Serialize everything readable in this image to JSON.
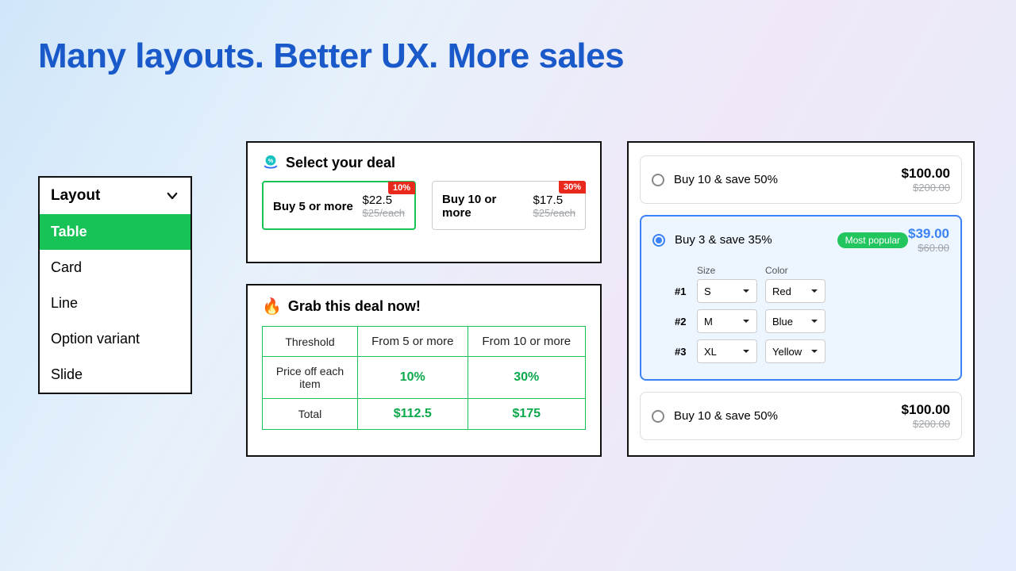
{
  "headline": "Many layouts. Better UX. More sales",
  "layout": {
    "title": "Layout",
    "items": [
      "Table",
      "Card",
      "Line",
      "Option variant",
      "Slide"
    ],
    "active_index": 0
  },
  "deals": {
    "title": "Select your deal",
    "cards": [
      {
        "label": "Buy 5 or more",
        "price": "$22.5",
        "old": "$25/each",
        "badge": "10%",
        "selected": true
      },
      {
        "label": "Buy 10 or more",
        "price": "$17.5",
        "old": "$25/each",
        "badge": "30%",
        "selected": false
      }
    ]
  },
  "grab": {
    "title": "Grab this deal now!",
    "emoji": "🔥",
    "headers": [
      "Threshold",
      "From 5 or more",
      "From 10 or more"
    ],
    "rows": [
      {
        "label": "Price off each item",
        "values": [
          "10%",
          "30%"
        ]
      },
      {
        "label": "Total",
        "values": [
          "$112.5",
          "$175"
        ]
      }
    ]
  },
  "variants": {
    "size_label": "Size",
    "color_label": "Color",
    "items": [
      {
        "label": "Buy 10 & save 50%",
        "price": "$100.00",
        "old": "$200.00",
        "selected": false,
        "tag": ""
      },
      {
        "label": "Buy 3 & save 35%",
        "price": "$39.00",
        "old": "$60.00",
        "selected": true,
        "tag": "Most popular",
        "options": [
          {
            "idx": "#1",
            "size": "S",
            "color": "Red"
          },
          {
            "idx": "#2",
            "size": "M",
            "color": "Blue"
          },
          {
            "idx": "#3",
            "size": "XL",
            "color": "Yellow"
          }
        ]
      },
      {
        "label": "Buy 10 & save 50%",
        "price": "$100.00",
        "old": "$200.00",
        "selected": false,
        "tag": ""
      }
    ]
  }
}
